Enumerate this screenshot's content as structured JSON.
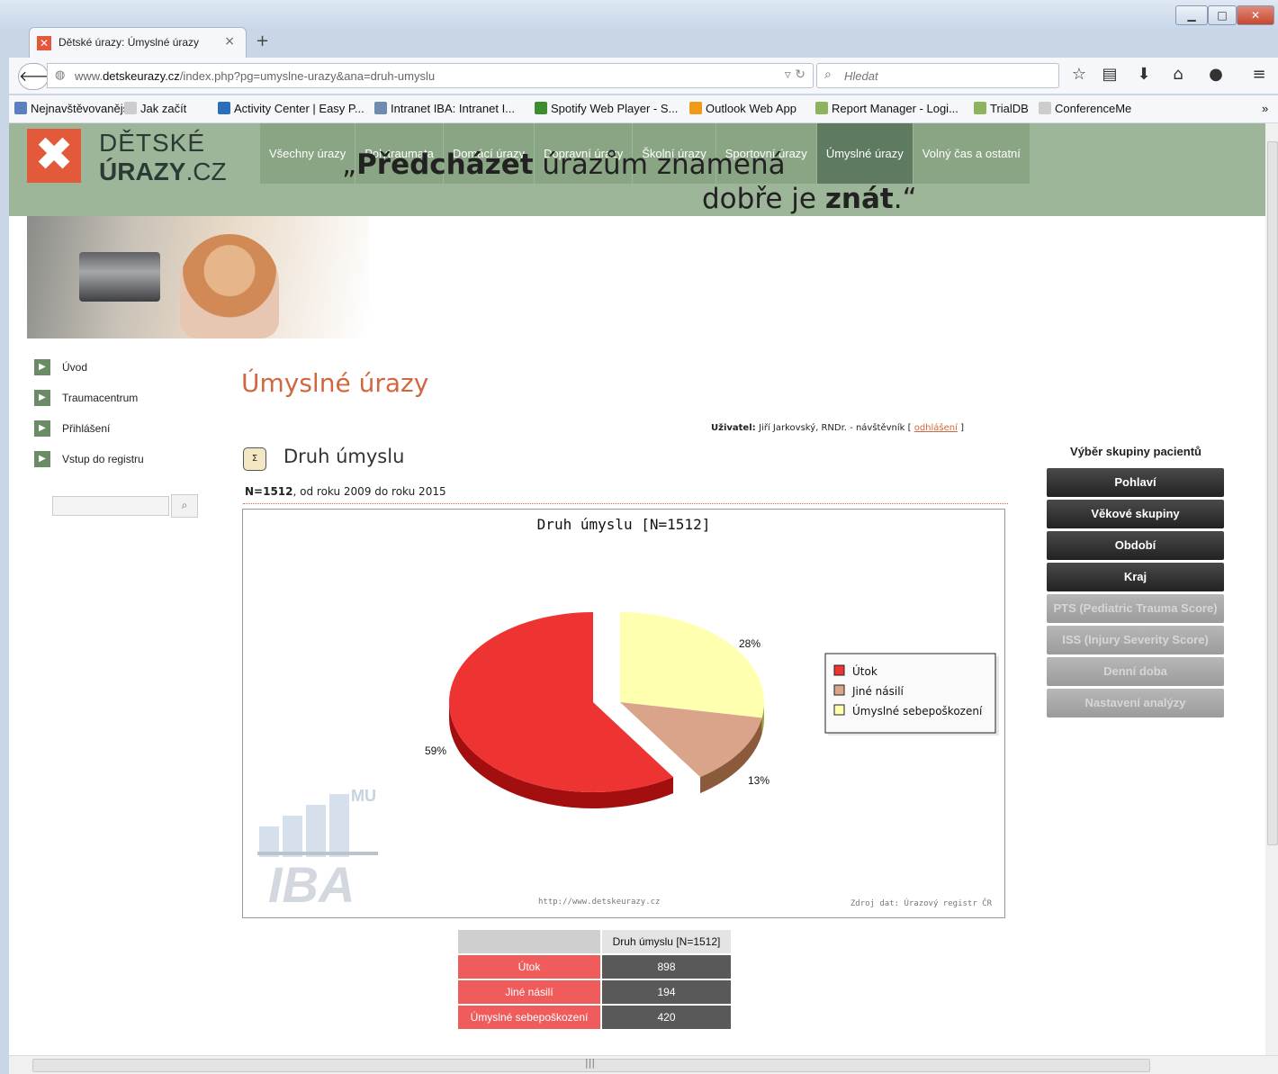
{
  "browser": {
    "tab_title": "Dětské úrazy: Úmyslné úrazy",
    "tab_close": "×",
    "new_tab": "+",
    "url_prefix": "www.",
    "url_domain": "detskeurazy.cz",
    "url_path": "/index.php?pg=umyslne-urazy&ana=druh-umyslu",
    "search_placeholder": "Hledat",
    "bookmarks": [
      {
        "label": "Nejnavštěvovanější",
        "icon": "page-icon",
        "color": "#5b7fbf"
      },
      {
        "label": "Jak začít",
        "icon": "blank-page-icon",
        "color": "#cccccc"
      },
      {
        "label": "Activity Center | Easy P...",
        "icon": "activity-icon",
        "color": "#2a6fb8"
      },
      {
        "label": "Intranet IBA: Intranet I...",
        "icon": "iba-icon",
        "color": "#6d8cb0"
      },
      {
        "label": "Spotify Web Player - S...",
        "icon": "spotify-icon",
        "color": "#3c8d2f"
      },
      {
        "label": "Outlook Web App",
        "icon": "outlook-icon",
        "color": "#f09a1a"
      },
      {
        "label": "Report Manager - Logi...",
        "icon": "diamond-icon",
        "color": "#8db35c"
      },
      {
        "label": "TrialDB",
        "icon": "diamond-icon",
        "color": "#8db35c"
      },
      {
        "label": "ConferenceMe",
        "icon": "blank-page-icon",
        "color": "#cccccc"
      }
    ],
    "bookmarks_overflow": "»"
  },
  "site": {
    "logo_line1": "DĚTSKÉ",
    "logo_line2_bold": "ÚRAZY",
    "logo_line2_rest": ".CZ",
    "menu": [
      {
        "label": "Všechny úrazy",
        "active": false
      },
      {
        "label": "Polytraumata",
        "active": false
      },
      {
        "label": "Domácí úrazy",
        "active": false
      },
      {
        "label": "Dopravní úrazy",
        "active": false
      },
      {
        "label": "Školní úrazy",
        "active": false
      },
      {
        "label": "Sportovní úrazy",
        "active": false
      },
      {
        "label": "Úmyslné úrazy",
        "active": true
      },
      {
        "label": "Volný čas a ostatní",
        "active": false
      }
    ],
    "quote_open": "„",
    "quote_bold1": "Předcházet",
    "quote_rest1": " úrazům znamená",
    "quote_rest2": "dobře je ",
    "quote_bold2": "znát",
    "quote_close": ".“"
  },
  "sidebar": {
    "items": [
      {
        "label": "Úvod"
      },
      {
        "label": "Traumacentrum"
      },
      {
        "label": "Přihlášení"
      },
      {
        "label": "Vstup do registru"
      }
    ],
    "search_button": "search-icon"
  },
  "content": {
    "title": "Úmyslné úrazy",
    "user_prefix": "Uživatel: ",
    "user_name": "Jiří Jarkovský, RNDr. - návštěvník",
    "user_bracket_open": " [ ",
    "logout": "odhlášení",
    "user_bracket_close": " ]",
    "subtitle": "Druh úmyslu",
    "n_bold": "N=1512",
    "n_rest": ", od roku 2009 do roku 2015"
  },
  "chart_data": {
    "type": "pie",
    "title": "Druh úmyslu [N=1512]",
    "categories": [
      "Útok",
      "Jiné násilí",
      "Úmyslné sebepoškození"
    ],
    "values": [
      898,
      194,
      420
    ],
    "percent_labels": [
      "59%",
      "13%",
      "28%"
    ],
    "colors": [
      "#ee3333",
      "#d9a48a",
      "#ffffb0"
    ],
    "side_colors": [
      "#a30f0f",
      "#8a5a3a",
      "#9ea33c"
    ],
    "legend_position": "right",
    "footer_url": "http://www.detskeurazy.cz",
    "footer_source": "Zdroj dat: Úrazový registr ČR",
    "watermark_mu": "MU",
    "watermark_iba": "IBA"
  },
  "table": {
    "header": "Druh úmyslu [N=1512]",
    "rows": [
      {
        "label": "Útok",
        "value": "898"
      },
      {
        "label": "Jiné násilí",
        "value": "194"
      },
      {
        "label": "Úmyslné sebepoškození",
        "value": "420"
      }
    ]
  },
  "right_panel": {
    "title": "Výběr skupiny pacientů",
    "buttons": [
      {
        "label": "Pohlaví",
        "enabled": true
      },
      {
        "label": "Věkové skupiny",
        "enabled": true
      },
      {
        "label": "Období",
        "enabled": true
      },
      {
        "label": "Kraj",
        "enabled": true
      },
      {
        "label": "PTS (Pediatric Trauma Score)",
        "enabled": false
      },
      {
        "label": "ISS (Injury Severity Score)",
        "enabled": false
      },
      {
        "label": "Denní doba",
        "enabled": false
      },
      {
        "label": "Nastavení analýzy",
        "enabled": false
      }
    ]
  }
}
